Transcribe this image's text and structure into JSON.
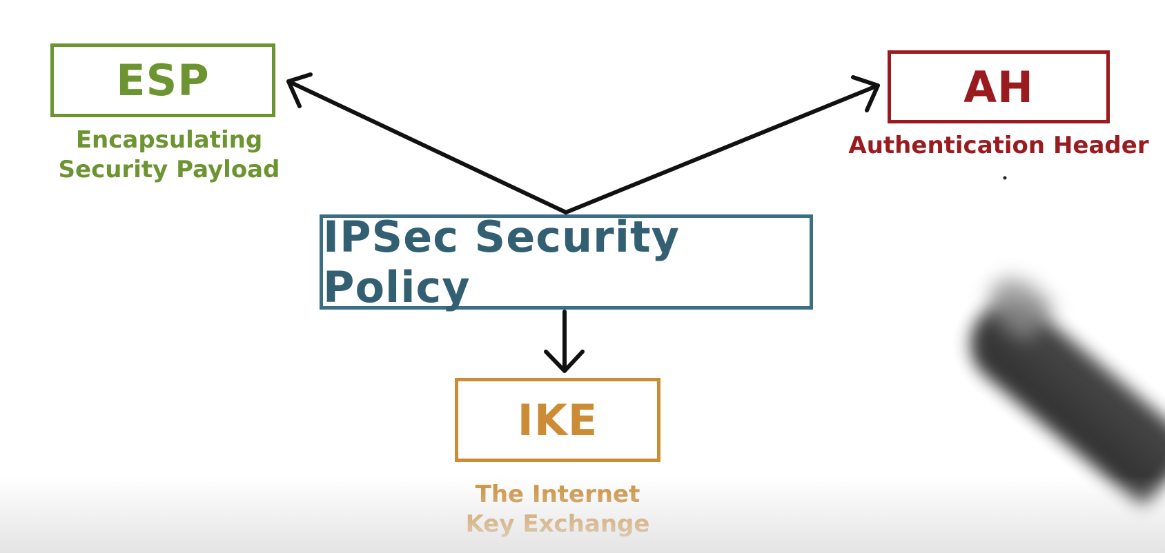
{
  "diagram": {
    "center": {
      "label": "IPSec Security Policy",
      "color": "#3b6f84"
    },
    "esp": {
      "label": "ESP",
      "caption": "Encapsulating\nSecurity Payload",
      "color": "#6c9430"
    },
    "ah": {
      "label": "AH",
      "caption": "Authentication Header",
      "color": "#9a1b1f"
    },
    "ike": {
      "label": "IKE",
      "caption": "The Internet\nKey Exchange",
      "color": "#cc8c36"
    },
    "arrow_color": "#111111"
  }
}
